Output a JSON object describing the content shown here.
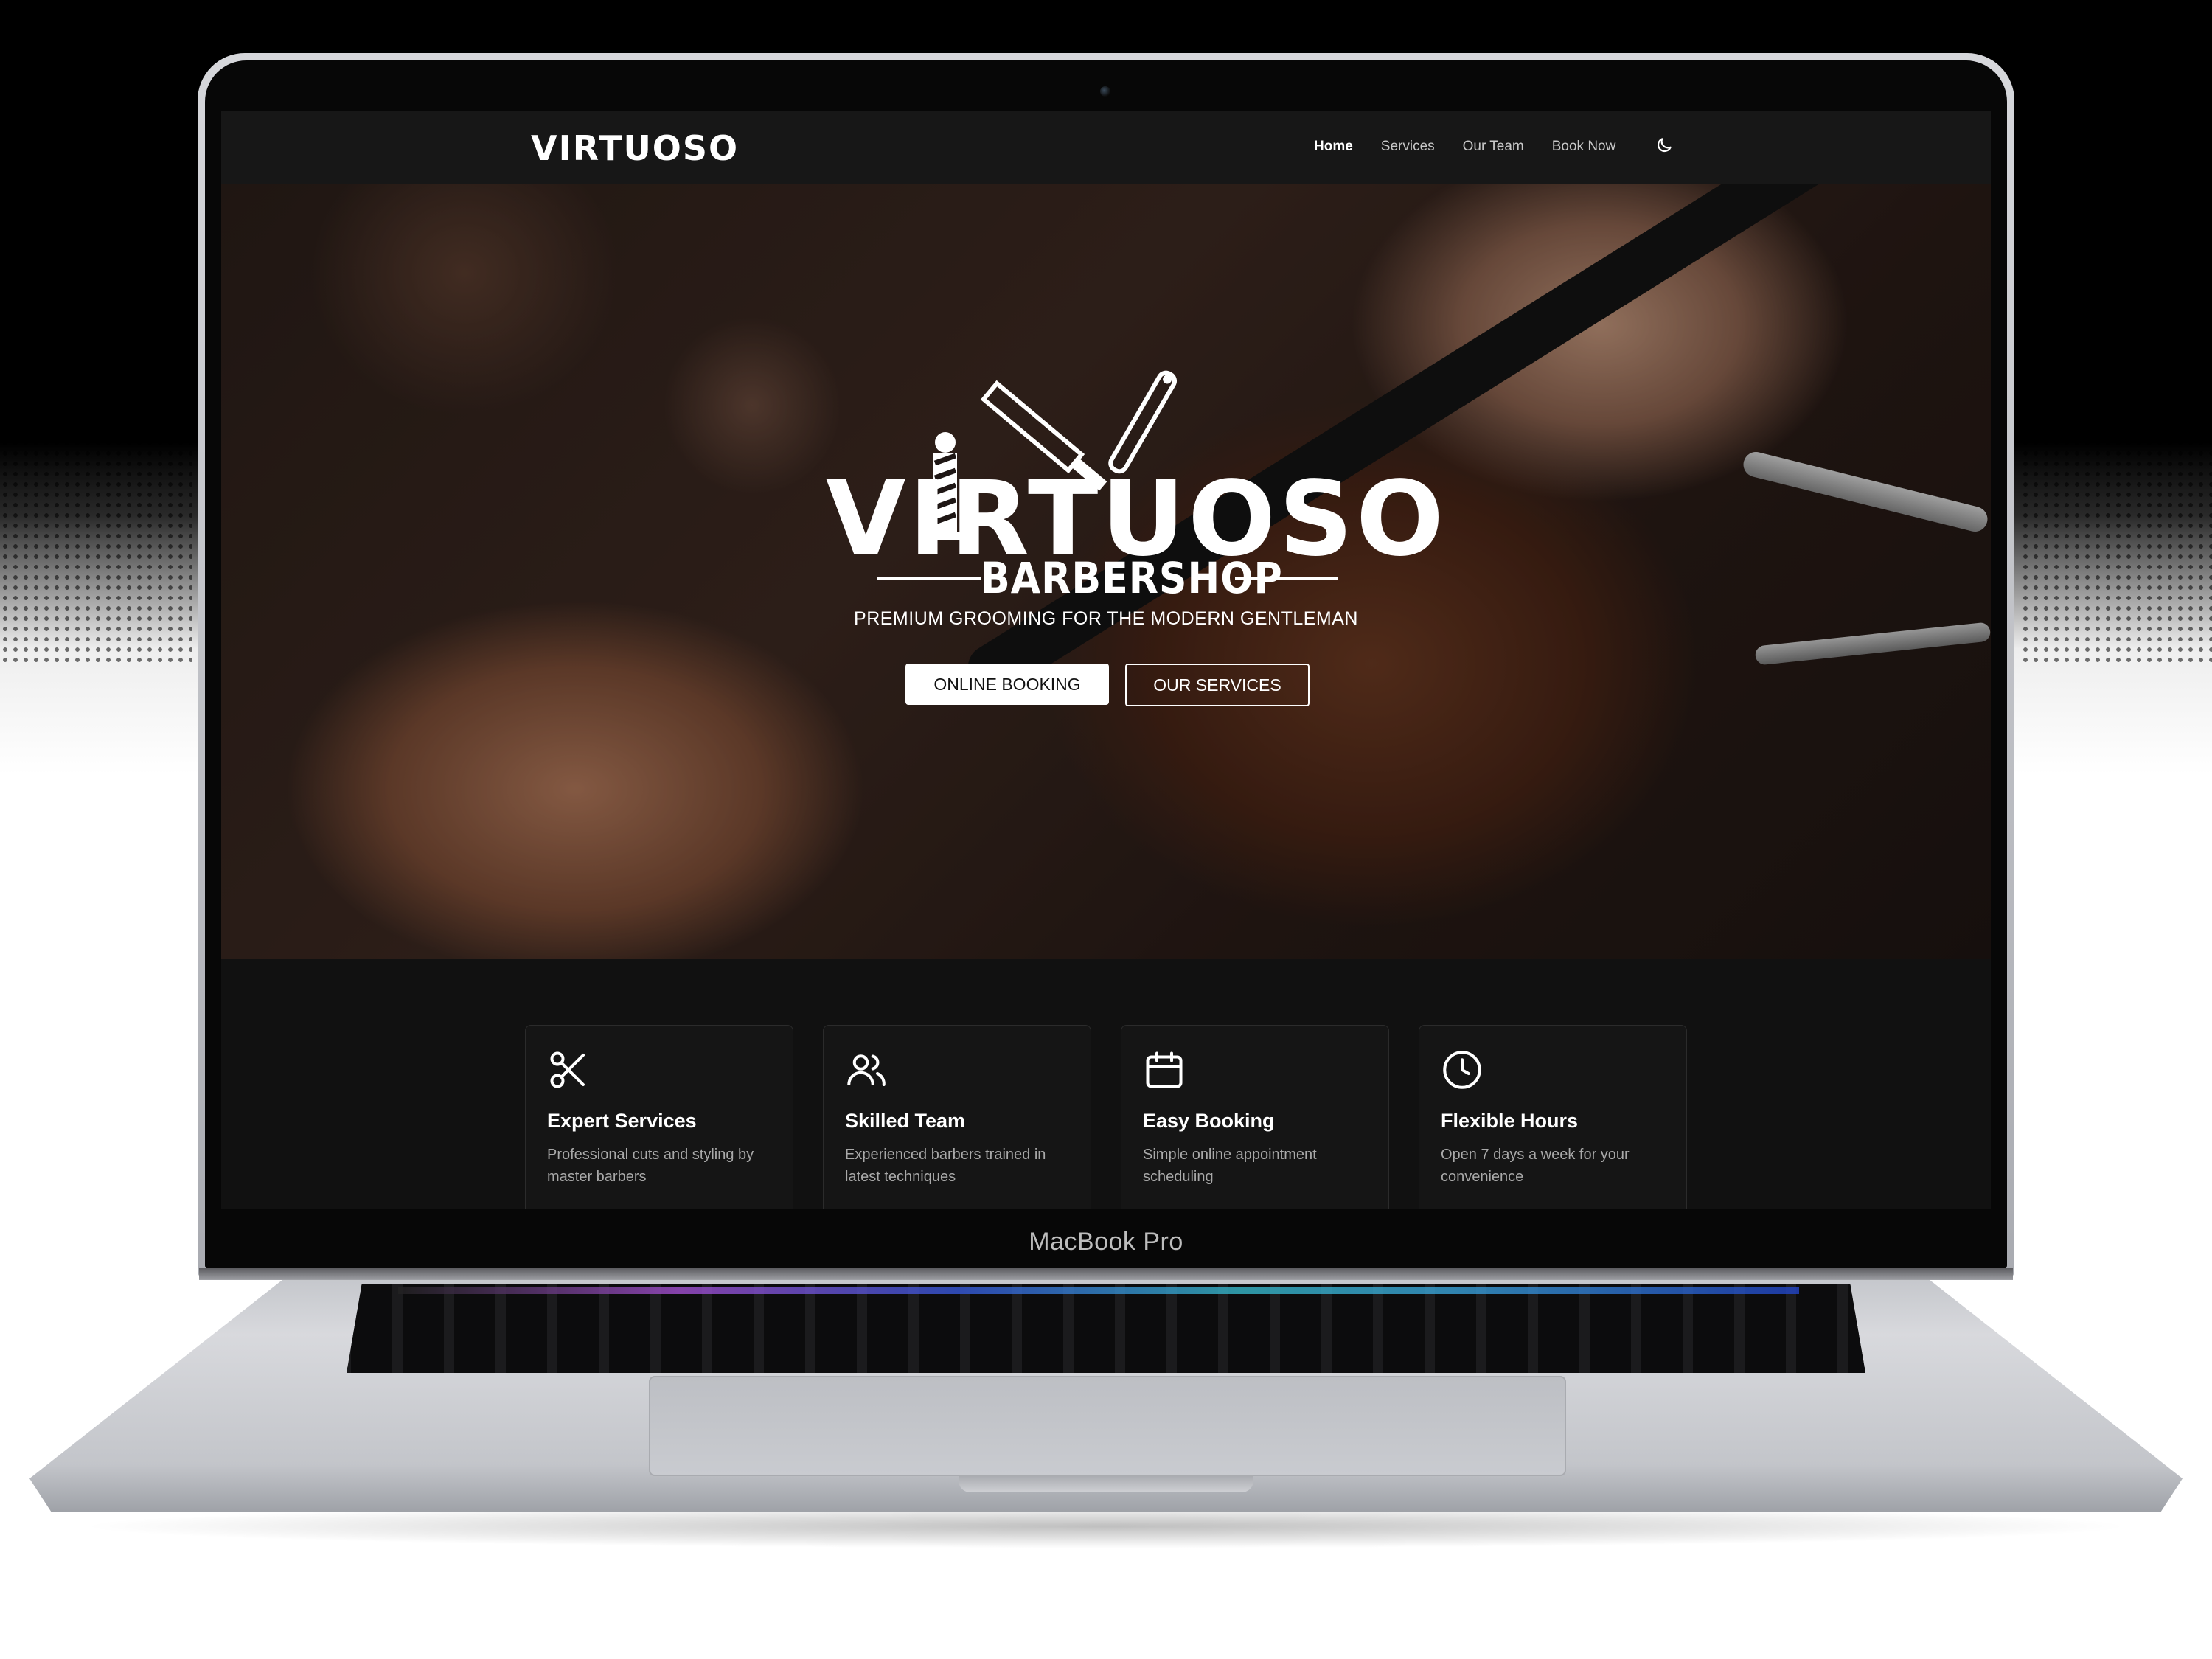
{
  "device": {
    "model_label": "MacBook Pro"
  },
  "nav": {
    "logo": "VIRTUOSO",
    "links": [
      "Home",
      "Services",
      "Our Team",
      "Book Now"
    ],
    "active": "Home"
  },
  "hero": {
    "title": "VIRTUOSO",
    "subtitle": "BARBERSHOP",
    "tagline": "PREMIUM GROOMING FOR THE MODERN GENTLEMAN",
    "primary_button": "ONLINE BOOKING",
    "secondary_button": "OUR SERVICES"
  },
  "features": [
    {
      "icon": "scissors-icon",
      "title": "Expert Services",
      "description": "Professional cuts and styling by master barbers"
    },
    {
      "icon": "users-icon",
      "title": "Skilled Team",
      "description": "Experienced barbers trained in latest techniques"
    },
    {
      "icon": "calendar-icon",
      "title": "Easy Booking",
      "description": "Simple online appointment scheduling"
    },
    {
      "icon": "clock-icon",
      "title": "Flexible Hours",
      "description": "Open 7 days a week for your convenience"
    }
  ],
  "colors": {
    "page_bg": "#111111",
    "nav_bg": "#171717",
    "card_bg": "#151515",
    "text": "#ffffff",
    "muted": "#a9a9a9"
  }
}
